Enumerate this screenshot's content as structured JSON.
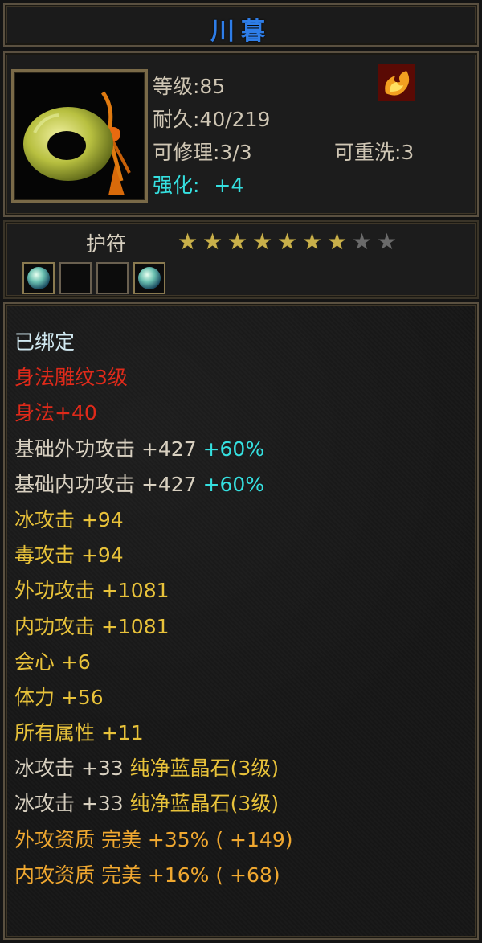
{
  "item": {
    "name": "川暮",
    "info": {
      "level": "等级:85",
      "durability": "耐久:40/219",
      "repair": "可修理:3/3",
      "rewash": "可重洗:3",
      "enhance_label": "强化:",
      "enhance_value": "+4"
    },
    "element_icon": "fire-element-icon",
    "type": "护符",
    "stars": {
      "filled": 7,
      "total": 9
    },
    "gem_slots": [
      {
        "filled": true,
        "icon": "blue-gem-icon"
      },
      {
        "filled": false
      },
      {
        "filled": false
      },
      {
        "filled": true,
        "icon": "blue-gem-icon"
      }
    ]
  },
  "colors": {
    "title": "#2e7de8",
    "white": "#d8d0c0",
    "bound": "#d0e8f0",
    "red": "#e02a1a",
    "cyan": "#35e0e0",
    "yellow": "#e8c23a",
    "gold": "#f0a830"
  },
  "attributes": [
    {
      "parts": [
        {
          "text": "已绑定",
          "color": "bound"
        }
      ]
    },
    {
      "parts": [
        {
          "text": "身法雕纹3级",
          "color": "red"
        }
      ]
    },
    {
      "parts": [
        {
          "text": "身法+40",
          "color": "red"
        }
      ]
    },
    {
      "parts": [
        {
          "text": "基础外功攻击  +427 ",
          "color": "white"
        },
        {
          "text": "+60%",
          "color": "cyan"
        }
      ]
    },
    {
      "parts": [
        {
          "text": "基础内功攻击  +427 ",
          "color": "white"
        },
        {
          "text": "+60%",
          "color": "cyan"
        }
      ]
    },
    {
      "parts": [
        {
          "text": "冰攻击  +94",
          "color": "yellow"
        }
      ]
    },
    {
      "parts": [
        {
          "text": "毒攻击  +94",
          "color": "yellow"
        }
      ]
    },
    {
      "parts": [
        {
          "text": "外功攻击  +1081",
          "color": "yellow"
        }
      ]
    },
    {
      "parts": [
        {
          "text": "内功攻击  +1081",
          "color": "yellow"
        }
      ]
    },
    {
      "parts": [
        {
          "text": "会心  +6",
          "color": "yellow"
        }
      ]
    },
    {
      "parts": [
        {
          "text": "体力  +56",
          "color": "yellow"
        }
      ]
    },
    {
      "parts": [
        {
          "text": "所有属性  +11",
          "color": "yellow"
        }
      ]
    },
    {
      "parts": [
        {
          "text": "冰攻击  +33  ",
          "color": "white"
        },
        {
          "text": "纯净蓝晶石(3级)",
          "color": "yellow"
        }
      ]
    },
    {
      "parts": [
        {
          "text": "冰攻击  +33  ",
          "color": "white"
        },
        {
          "text": "纯净蓝晶石(3级)",
          "color": "yellow"
        }
      ]
    },
    {
      "parts": [
        {
          "text": "外攻资质   完美  +35% ( +149)",
          "color": "gold"
        }
      ]
    },
    {
      "parts": [
        {
          "text": "内攻资质   完美  +16% ( +68)",
          "color": "gold"
        }
      ]
    }
  ]
}
